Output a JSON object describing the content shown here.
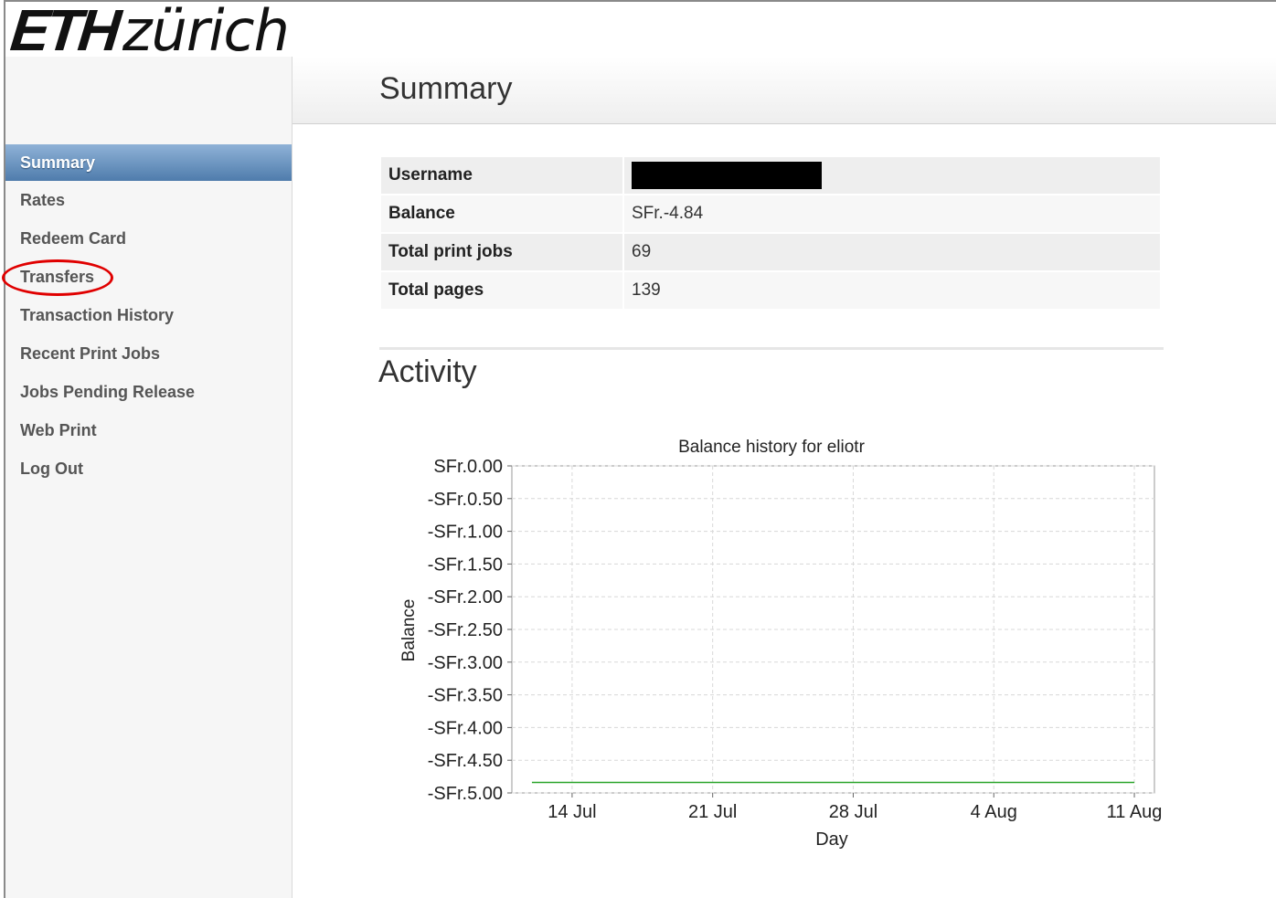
{
  "logo": {
    "eth": "ETH",
    "zurich": "zürich"
  },
  "sidebar": {
    "items": [
      {
        "label": "Summary",
        "active": true
      },
      {
        "label": "Rates"
      },
      {
        "label": "Redeem Card"
      },
      {
        "label": "Transfers",
        "highlighted": true
      },
      {
        "label": "Transaction History"
      },
      {
        "label": "Recent Print Jobs"
      },
      {
        "label": "Jobs Pending Release"
      },
      {
        "label": "Web Print"
      },
      {
        "label": "Log Out"
      }
    ],
    "active_color": "#4f7cac",
    "highlight_color": "#e00000"
  },
  "header": {
    "title": "Summary"
  },
  "summary": {
    "username_label": "Username",
    "balance_label": "Balance",
    "balance_value": "SFr.-4.84",
    "print_jobs_label": "Total print jobs",
    "print_jobs_value": "69",
    "pages_label": "Total pages",
    "pages_value": "139"
  },
  "activity": {
    "title": "Activity"
  },
  "chart_data": {
    "type": "line",
    "title": "Balance history for eliotr",
    "xlabel": "Day",
    "ylabel": "Balance",
    "ylim": [
      -5.0,
      0.0
    ],
    "yticks": [
      0,
      -0.5,
      -1.0,
      -1.5,
      -2.0,
      -2.5,
      -3.0,
      -3.5,
      -4.0,
      -4.5,
      -5.0
    ],
    "ytick_labels": [
      "SFr.0.00",
      "-SFr.0.50",
      "-SFr.1.00",
      "-SFr.1.50",
      "-SFr.2.00",
      "-SFr.2.50",
      "-SFr.3.00",
      "-SFr.3.50",
      "-SFr.4.00",
      "-SFr.4.50",
      "-SFr.5.00"
    ],
    "xticks": [
      "14 Jul",
      "21 Jul",
      "28 Jul",
      "4 Aug",
      "11 Aug"
    ],
    "grid": true,
    "series": [
      {
        "x": [
          "12 Jul",
          "11 Aug"
        ],
        "values": [
          -4.84,
          -4.84
        ],
        "color": "#2aa52a"
      }
    ]
  }
}
